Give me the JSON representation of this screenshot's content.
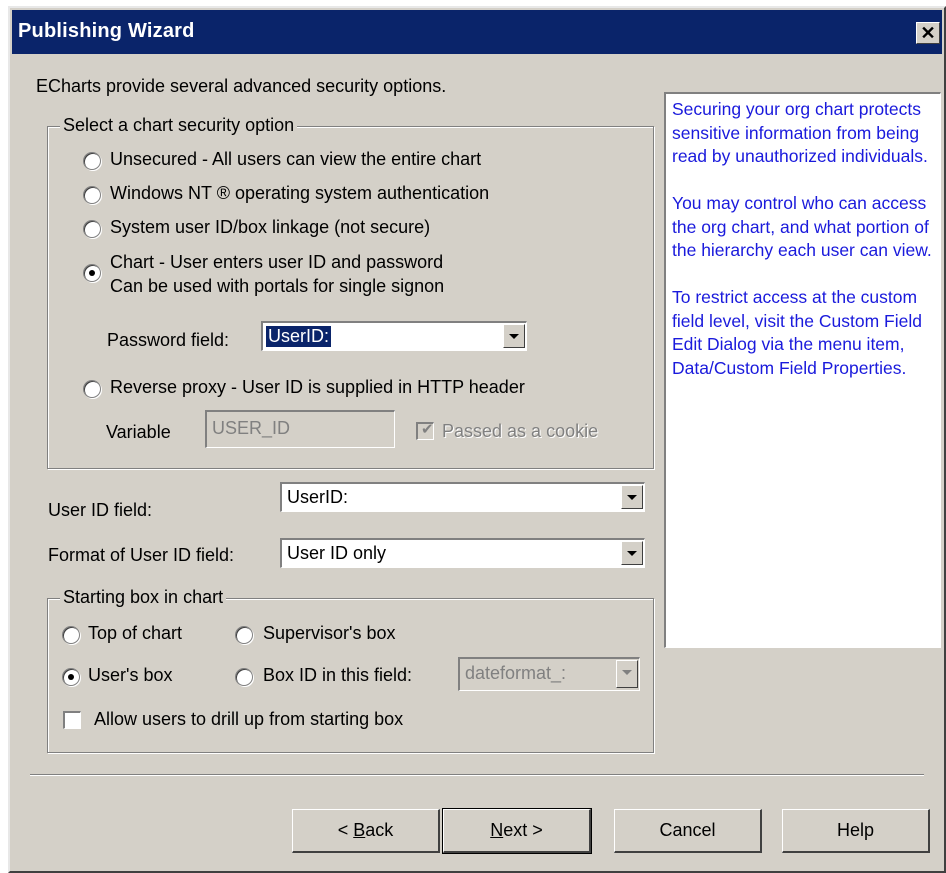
{
  "window": {
    "title": "Publishing Wizard",
    "close_glyph": "✕"
  },
  "intro_text": "ECharts provide several advanced security options.",
  "security_group": {
    "legend": "Select a chart security option",
    "options": {
      "unsecured": "Unsecured - All users can view the entire chart",
      "windows_nt": "Windows NT ® operating system authentication",
      "system_user": "System user ID/box linkage (not secure)",
      "chart_line1": "Chart - User enters user ID and password",
      "chart_line2": "Can be used with portals for single signon",
      "reverse_proxy": "Reverse proxy - User ID is supplied in HTTP header"
    },
    "selected": "chart",
    "password_field": {
      "label": "Password field:",
      "value": "UserID:"
    },
    "variable": {
      "label": "Variable",
      "value": "USER_ID"
    },
    "cookie": {
      "label": "Passed as a cookie",
      "checked": true,
      "enabled": false
    }
  },
  "user_id_field": {
    "label": "User ID field:",
    "value": "UserID:"
  },
  "format_field": {
    "label": "Format of User ID field:",
    "value": "User ID only"
  },
  "starting_group": {
    "legend": "Starting box in chart",
    "top_of_chart": "Top of chart",
    "supervisors_box": "Supervisor's box",
    "users_box": "User's box",
    "box_id_label": "Box ID in this field:",
    "box_id_value": "dateformat_:",
    "selected": "users_box",
    "drill_up": {
      "label": "Allow users to drill up from starting box",
      "checked": false
    }
  },
  "info": {
    "para1": "Securing your org chart protects sensitive information from being read by unauthorized individuals.",
    "para2": "You may control who can access the org chart, and what portion of the hierarchy each user can view.",
    "para3": "To restrict access at the custom field level, visit the Custom Field Edit Dialog via the menu item, Data/Custom Field Properties."
  },
  "buttons": {
    "back_mnemonic": "B",
    "back_rest": "ack",
    "back_prefix": "< ",
    "next_mnemonic": "N",
    "next_rest": "ext >",
    "cancel": "Cancel",
    "help": "Help"
  },
  "colors": {
    "title_bar": "#0a246a",
    "face": "#d4d0c8",
    "info_text": "#1a1adc"
  }
}
